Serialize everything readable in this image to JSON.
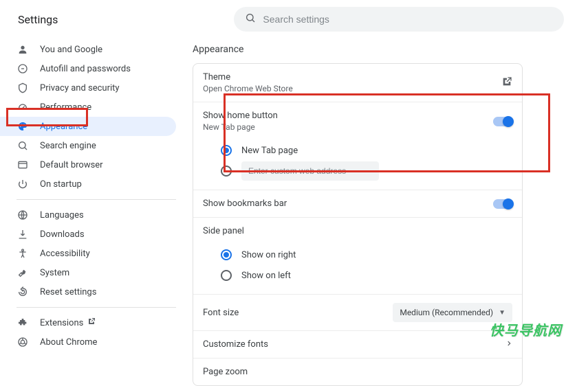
{
  "title": "Settings",
  "search": {
    "placeholder": "Search settings"
  },
  "sidebar": {
    "items": [
      {
        "label": "You and Google"
      },
      {
        "label": "Autofill and passwords"
      },
      {
        "label": "Privacy and security"
      },
      {
        "label": "Performance"
      },
      {
        "label": "Appearance"
      },
      {
        "label": "Search engine"
      },
      {
        "label": "Default browser"
      },
      {
        "label": "On startup"
      }
    ],
    "items2": [
      {
        "label": "Languages"
      },
      {
        "label": "Downloads"
      },
      {
        "label": "Accessibility"
      },
      {
        "label": "System"
      },
      {
        "label": "Reset settings"
      }
    ],
    "items3": [
      {
        "label": "Extensions"
      },
      {
        "label": "About Chrome"
      }
    ]
  },
  "main": {
    "section_title": "Appearance",
    "theme": {
      "label": "Theme",
      "sublabel": "Open Chrome Web Store"
    },
    "home_button": {
      "label": "Show home button",
      "sublabel": "New Tab page",
      "option_newtab": "New Tab page",
      "custom_placeholder": "Enter custom web address"
    },
    "bookmarks": {
      "label": "Show bookmarks bar"
    },
    "side_panel": {
      "label": "Side panel",
      "option_right": "Show on right",
      "option_left": "Show on left"
    },
    "font_size": {
      "label": "Font size",
      "value": "Medium (Recommended)"
    },
    "customize_fonts": {
      "label": "Customize fonts"
    },
    "page_zoom": {
      "label": "Page zoom"
    }
  },
  "watermark": "快马导航网"
}
